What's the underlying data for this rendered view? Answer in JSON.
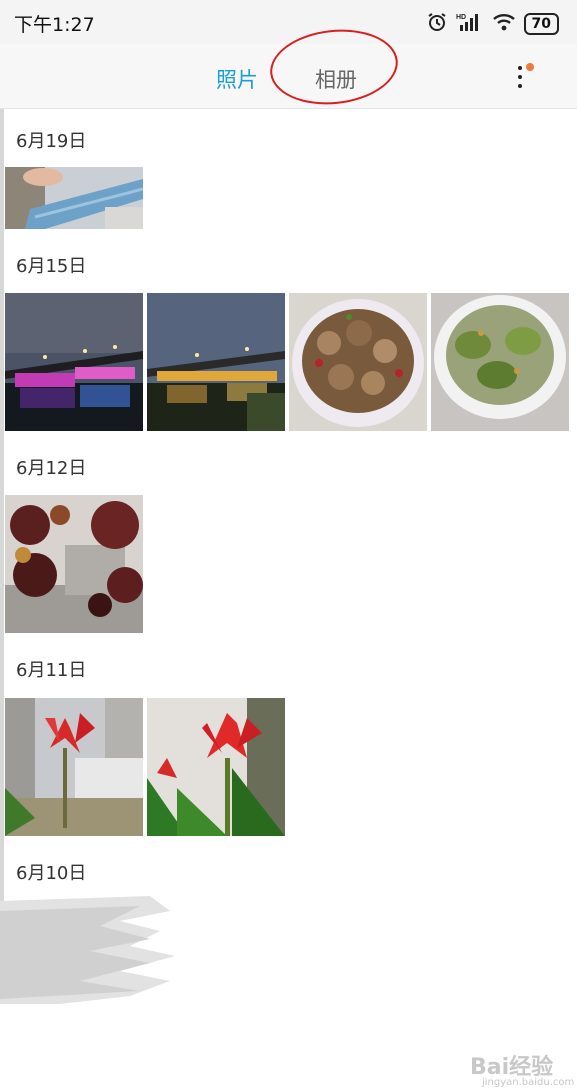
{
  "status_bar": {
    "time": "下午1:27",
    "battery": "70",
    "hd_label": "HD",
    "icons": [
      "alarm-icon",
      "signal-icon",
      "wifi-icon",
      "battery-icon"
    ]
  },
  "header": {
    "tab_photos": "照片",
    "tab_albums": "相册",
    "active_color": "#1b9ed8",
    "badge_color": "#f07a3e"
  },
  "groups": [
    {
      "date": "6月19日",
      "photos": [
        "baby-legs-photo"
      ]
    },
    {
      "date": "6月15日",
      "photos": [
        "bridge-night-photo-1",
        "bridge-night-photo-2",
        "clams-dish-photo",
        "scallops-dish-photo"
      ]
    },
    {
      "date": "6月12日",
      "photos": [
        "red-leaves-photo"
      ]
    },
    {
      "date": "6月11日",
      "photos": [
        "red-flower-photo-1",
        "red-flower-photo-2"
      ]
    },
    {
      "date": "6月10日",
      "photos": []
    }
  ],
  "watermark": {
    "brand": "Bai经验",
    "url": "jingyan.baidu.com"
  }
}
